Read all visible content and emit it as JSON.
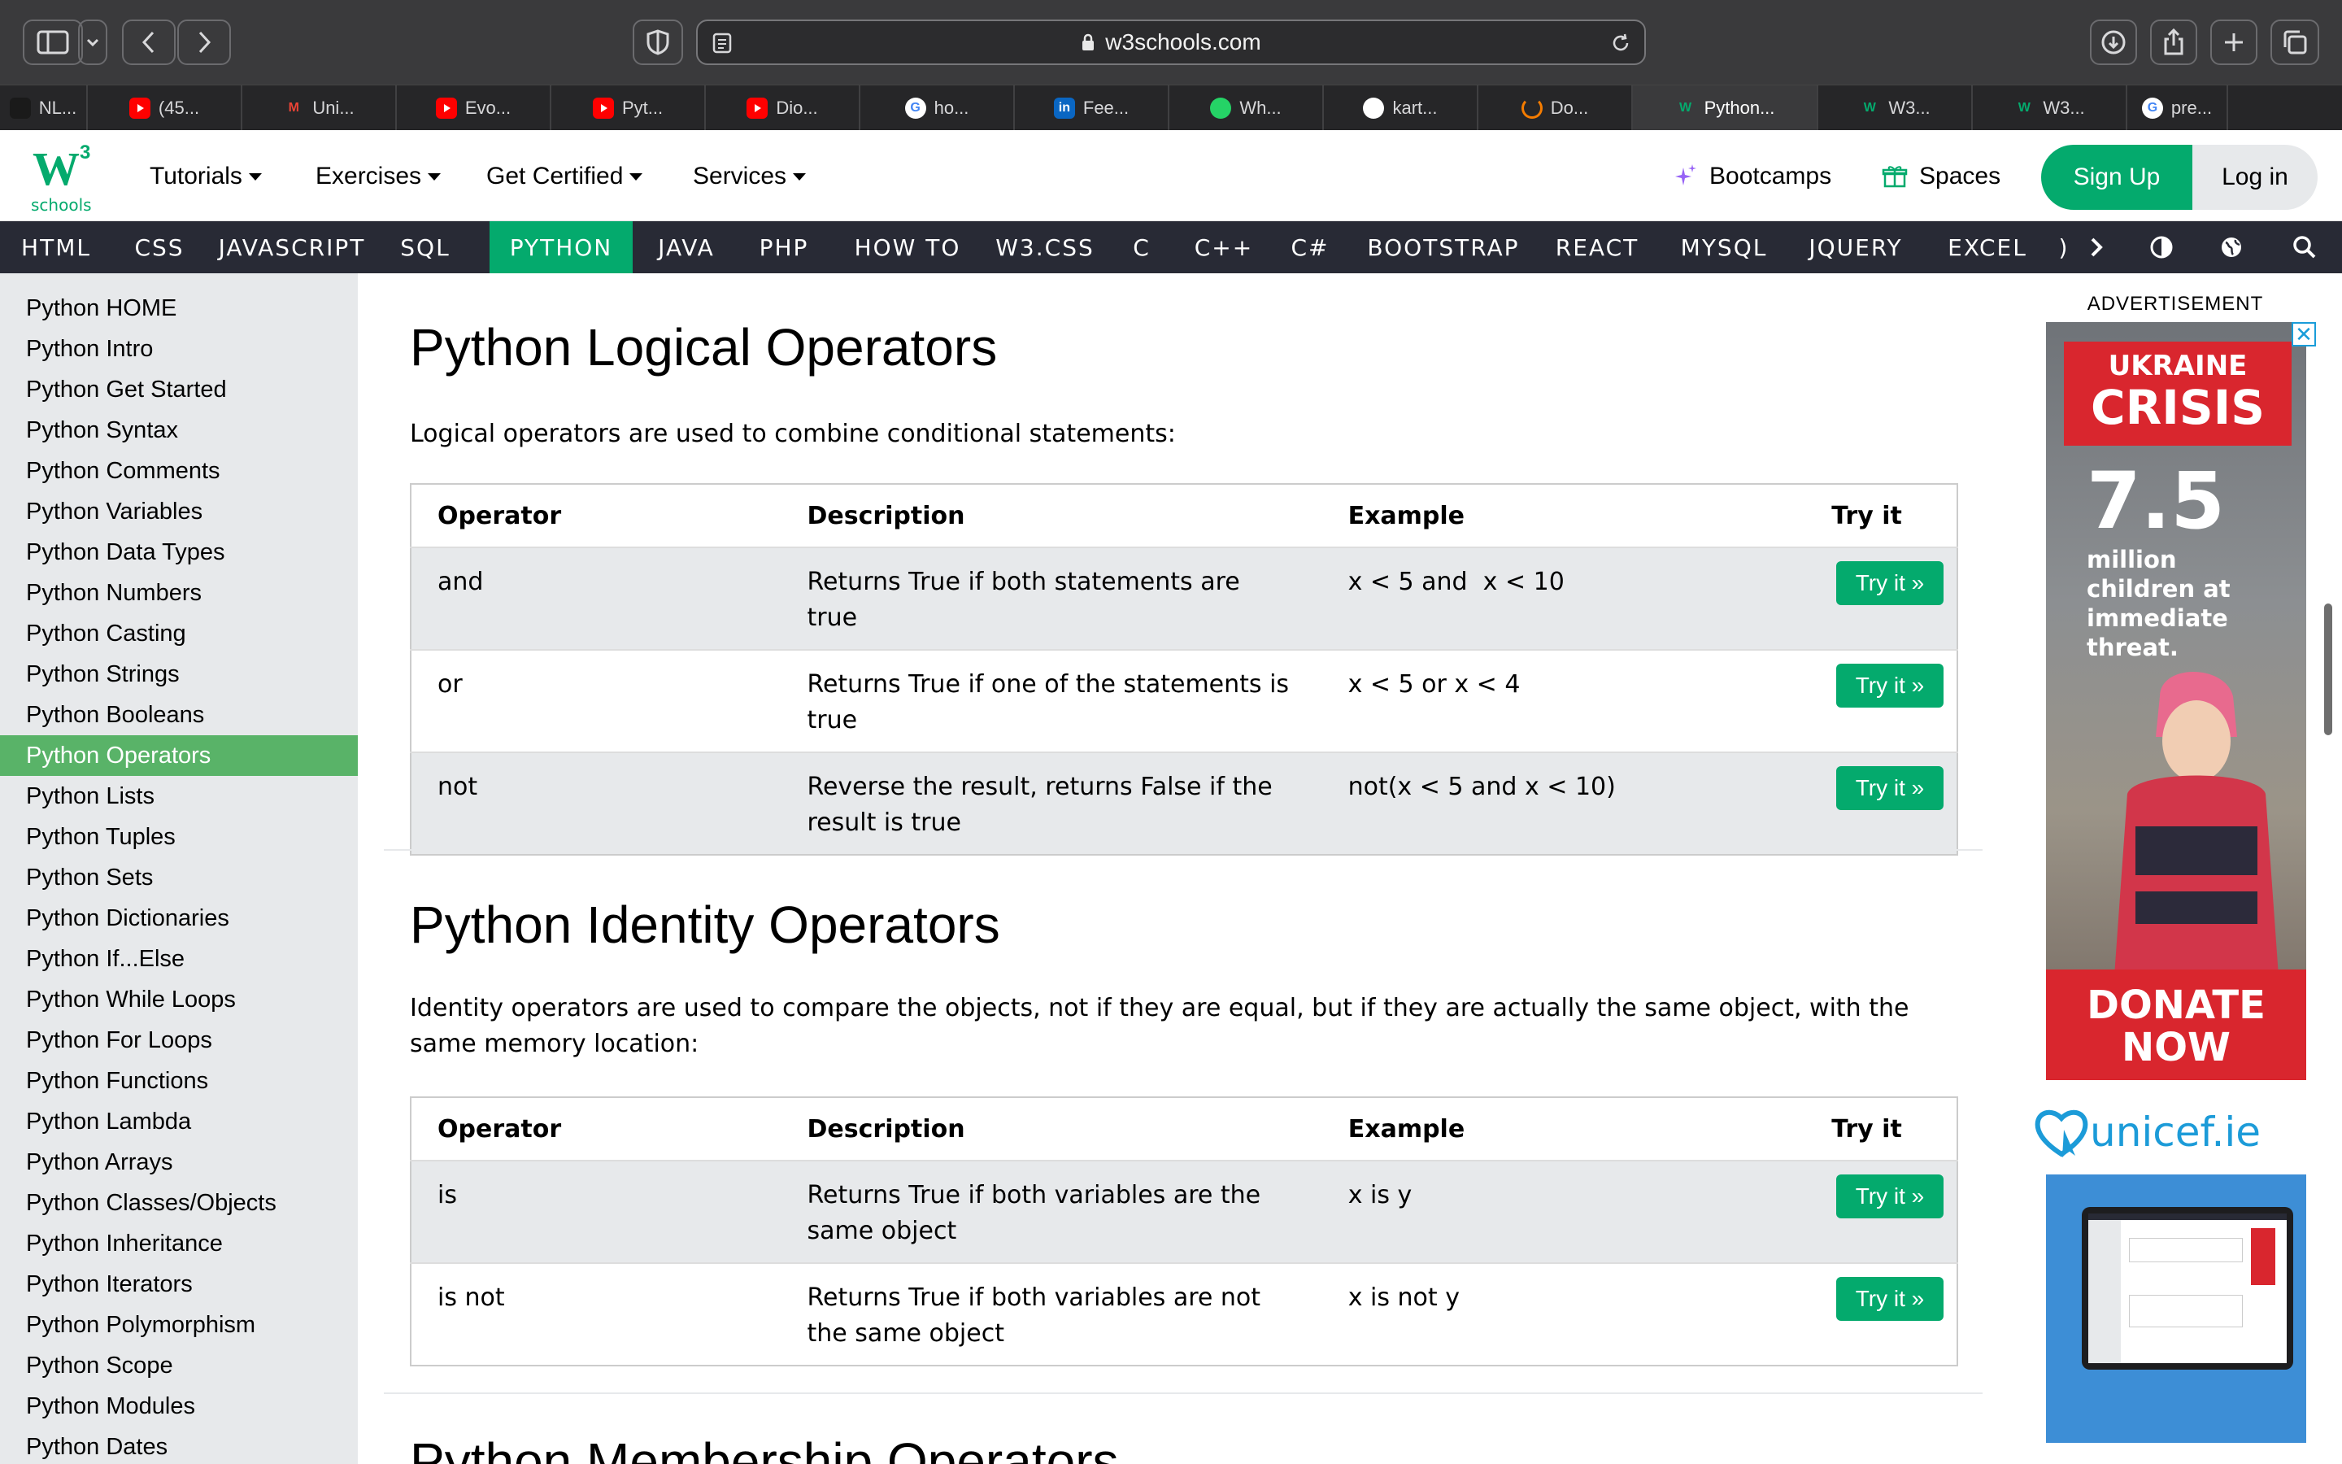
{
  "browser": {
    "url": "w3schools.com",
    "tabs": [
      {
        "label": "NL...",
        "icon": "openai-icon",
        "color": "#1a1a1a"
      },
      {
        "label": "(45...",
        "icon": "youtube-icon",
        "color": "#ff0000"
      },
      {
        "label": "Uni...",
        "icon": "gmail-icon",
        "color": "#ea4335"
      },
      {
        "label": "Evo...",
        "icon": "youtube-icon",
        "color": "#ff0000"
      },
      {
        "label": "Pyt...",
        "icon": "youtube-icon",
        "color": "#ff0000"
      },
      {
        "label": "Dio...",
        "icon": "youtube-icon",
        "color": "#ff0000"
      },
      {
        "label": "ho...",
        "icon": "google-icon",
        "color": "#4285f4"
      },
      {
        "label": "Fee...",
        "icon": "linkedin-icon",
        "color": "#0a66c2"
      },
      {
        "label": "Wh...",
        "icon": "whatsapp-icon",
        "color": "#25d366"
      },
      {
        "label": "kart...",
        "icon": "github-icon",
        "color": "#ffffff"
      },
      {
        "label": "Do...",
        "icon": "loading-icon",
        "color": "#f57c00"
      },
      {
        "label": "Python...",
        "icon": "w3schools-icon",
        "color": "#04aa6d"
      },
      {
        "label": "W3...",
        "icon": "w3schools-icon",
        "color": "#04aa6d"
      },
      {
        "label": "W3...",
        "icon": "w3schools-icon",
        "color": "#04aa6d"
      },
      {
        "label": "pre...",
        "icon": "google-icon",
        "color": "#4285f4"
      }
    ]
  },
  "header": {
    "logo_letter": "W",
    "logo_sup": "3",
    "logo_text": "schools",
    "menus": [
      "Tutorials",
      "Exercises",
      "Get Certified",
      "Services"
    ],
    "bootcamps": "Bootcamps",
    "spaces": "Spaces",
    "signup": "Sign Up",
    "login": "Log in"
  },
  "topnav": {
    "items": [
      "HTML",
      "CSS",
      "JAVASCRIPT",
      "SQL",
      "PYTHON",
      "JAVA",
      "PHP",
      "HOW TO",
      "W3.CSS",
      "C",
      "C++",
      "C#",
      "BOOTSTRAP",
      "REACT",
      "MYSQL",
      "JQUERY",
      "EXCEL"
    ],
    "active": "PYTHON",
    "cut_off": ")"
  },
  "sidebar": {
    "items": [
      "Python HOME",
      "Python Intro",
      "Python Get Started",
      "Python Syntax",
      "Python Comments",
      "Python Variables",
      "Python Data Types",
      "Python Numbers",
      "Python Casting",
      "Python Strings",
      "Python Booleans",
      "Python Operators",
      "Python Lists",
      "Python Tuples",
      "Python Sets",
      "Python Dictionaries",
      "Python If...Else",
      "Python While Loops",
      "Python For Loops",
      "Python Functions",
      "Python Lambda",
      "Python Arrays",
      "Python Classes/Objects",
      "Python Inheritance",
      "Python Iterators",
      "Python Polymorphism",
      "Python Scope",
      "Python Modules",
      "Python Dates"
    ],
    "active": "Python Operators"
  },
  "logical": {
    "title": "Python Logical Operators",
    "intro": "Logical operators are used to combine conditional statements:",
    "headers": [
      "Operator",
      "Description",
      "Example",
      "Try it"
    ],
    "rows": [
      {
        "op": "and",
        "desc": "Returns True if both statements are true",
        "example": "x < 5 and  x < 10",
        "try": "Try it »"
      },
      {
        "op": "or",
        "desc": "Returns True if one of the statements is true",
        "example": "x < 5 or x < 4",
        "try": "Try it »"
      },
      {
        "op": "not",
        "desc": "Reverse the result, returns False if the result is true",
        "example": "not(x < 5 and x < 10)",
        "try": "Try it »"
      }
    ]
  },
  "identity": {
    "title": "Python Identity Operators",
    "intro": "Identity operators are used to compare the objects, not if they are equal, but if they are actually the same object, with the same memory location:",
    "headers": [
      "Operator",
      "Description",
      "Example",
      "Try it"
    ],
    "rows": [
      {
        "op": "is",
        "desc": "Returns True if both variables are the same object",
        "example": "x is y",
        "try": "Try it »"
      },
      {
        "op": "is not",
        "desc": "Returns True if both variables are not the same object",
        "example": "x is not y",
        "try": "Try it »"
      }
    ]
  },
  "membership": {
    "title": "Python Membership Operators"
  },
  "ad": {
    "label": "ADVERTISEMENT",
    "ukraine": "UKRAINE",
    "crisis": "CRISIS",
    "number": "7.5",
    "subtext": "million children at immediate threat.",
    "donate": "DONATE NOW",
    "brand": "unicef.ie",
    "close": "✕"
  },
  "colors": {
    "accent": "#04aa6d",
    "nav_bg": "#282a35",
    "sidebar_bg": "#e7e9eb",
    "sidebar_active": "#59b368"
  }
}
